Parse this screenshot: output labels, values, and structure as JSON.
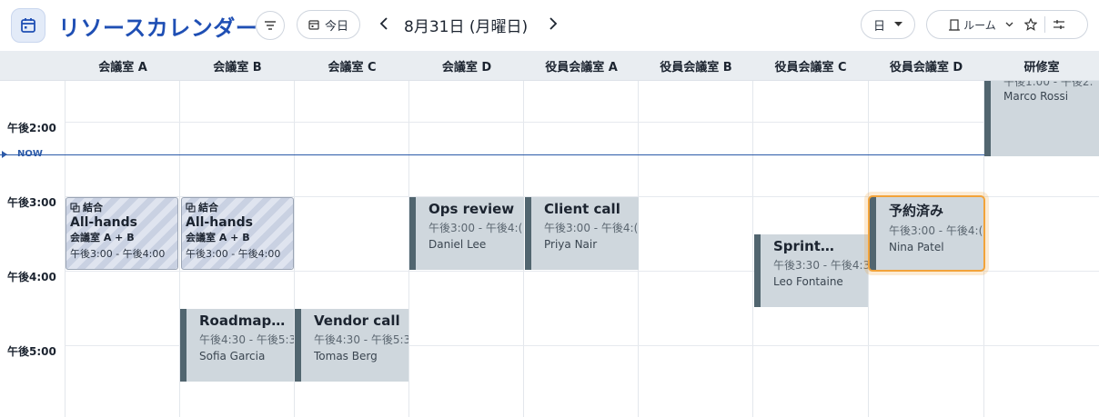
{
  "app": {
    "title": "リソースカレンダー",
    "icon": "calendar-icon"
  },
  "toolbar": {
    "today_label": "今日",
    "date_title": "8月31日 (月曜日)",
    "view_value": "日",
    "resource_label": "ルーム"
  },
  "columns": [
    "会議室 A",
    "会議室 B",
    "会議室 C",
    "会議室 D",
    "役員会議室 A",
    "役員会議室 B",
    "役員会議室 C",
    "役員会議室 D",
    "研修室"
  ],
  "times": [
    "午後2:00",
    "午後3:00",
    "午後4:00",
    "午後5:00"
  ],
  "now_label": "NOW",
  "top_event": {
    "time": "午後1:00 - 午後2:",
    "person": "Marco Rossi"
  },
  "merged_events": [
    {
      "badge": "結合",
      "title": "All-hands",
      "rooms": "会議室 A + B",
      "time": "午後3:00 - 午後4:00"
    },
    {
      "badge": "結合",
      "title": "All-hands",
      "rooms": "会議室 A + B",
      "time": "午後3:00 - 午後4:00"
    }
  ],
  "events": [
    {
      "title": "Ops review",
      "time": "午後3:00 - 午後4:(",
      "person": "Daniel Lee"
    },
    {
      "title": "Client call",
      "time": "午後3:00 - 午後4:(",
      "person": "Priya Nair"
    },
    {
      "title": "Sprint…",
      "time": "午後3:30 - 午後4:3",
      "person": "Leo Fontaine"
    },
    {
      "title": "予約済み",
      "time": "午後3:00 - 午後4:(",
      "person": "Nina Patel"
    },
    {
      "title": "Roadmap…",
      "time": "午後4:30 - 午後5:3",
      "person": "Sofia Garcia"
    },
    {
      "title": "Vendor call",
      "time": "午後4:30 - 午後5:3",
      "person": "Tomas Berg"
    }
  ],
  "colors": {
    "accent": "#1f4fb4",
    "event_bg": "#cfd7dd",
    "event_bar": "#51656f",
    "selected": "#f2a33a",
    "now": "#2c5aa8"
  }
}
